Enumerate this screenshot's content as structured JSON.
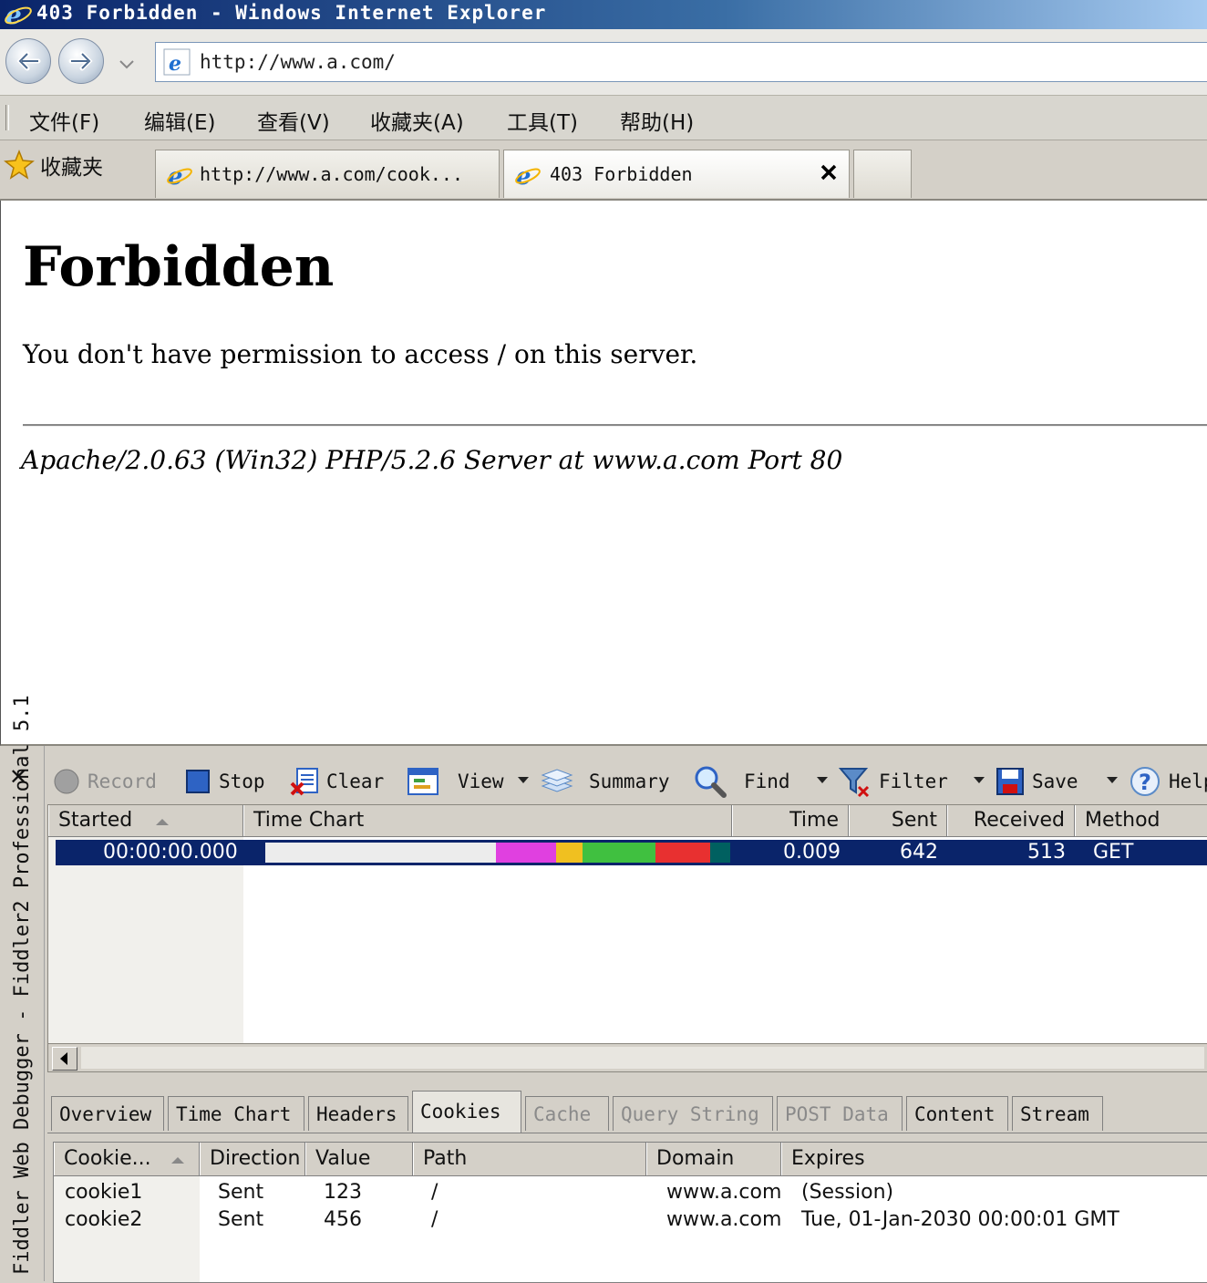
{
  "window": {
    "title": "403 Forbidden - Windows Internet Explorer"
  },
  "address_bar": {
    "url": "http://www.a.com/"
  },
  "menu": [
    "文件(F)",
    "编辑(E)",
    "查看(V)",
    "收藏夹(A)",
    "工具(T)",
    "帮助(H)"
  ],
  "favorites": {
    "label": "收藏夹"
  },
  "tabs": [
    {
      "label": "http://www.a.com/cook..."
    },
    {
      "label": "403 Forbidden"
    }
  ],
  "page": {
    "heading": "Forbidden",
    "message": "You don't have permission to access / on this server.",
    "signature": "Apache/2.0.63 (Win32) PHP/5.2.6 Server at www.a.com Port 80"
  },
  "fiddler": {
    "side_label": "Fiddler Web Debugger - Fiddler2 Professional 5.1",
    "toolbar": {
      "record": "Record",
      "stop": "Stop",
      "clear": "Clear",
      "view": "View",
      "summary": "Summary",
      "find": "Find",
      "filter": "Filter",
      "save": "Save",
      "help": "Help"
    },
    "sessions": {
      "columns": [
        "Started",
        "Time Chart",
        "Time",
        "Sent",
        "Received",
        "Method"
      ],
      "rows": [
        {
          "started": "00:00:00.000",
          "time": "0.009",
          "sent": "642",
          "received": "513",
          "method": "GET"
        }
      ],
      "timechart_segments": [
        {
          "color": "#e040e0",
          "start": 0.496,
          "end": 0.625
        },
        {
          "color": "#f0c020",
          "start": 0.625,
          "end": 0.682
        },
        {
          "color": "#40c040",
          "start": 0.682,
          "end": 0.839
        },
        {
          "color": "#e83030",
          "start": 0.839,
          "end": 0.957
        },
        {
          "color": "#006060",
          "start": 0.957,
          "end": 1.0
        }
      ]
    },
    "inspector_tabs": [
      "Overview",
      "Time Chart",
      "Headers",
      "Cookies",
      "Cache",
      "Query String",
      "POST Data",
      "Content",
      "Stream"
    ],
    "cookies": {
      "columns": [
        "Cookie...",
        "Direction",
        "Value",
        "Path",
        "Domain",
        "Expires"
      ],
      "rows": [
        {
          "name": "cookie1",
          "direction": "Sent",
          "value": "123",
          "path": "/",
          "domain": "www.a.com",
          "expires": "(Session)"
        },
        {
          "name": "cookie2",
          "direction": "Sent",
          "value": "456",
          "path": "/",
          "domain": "www.a.com",
          "expires": "Tue, 01-Jan-2030 00:00:01 GMT"
        }
      ]
    }
  }
}
